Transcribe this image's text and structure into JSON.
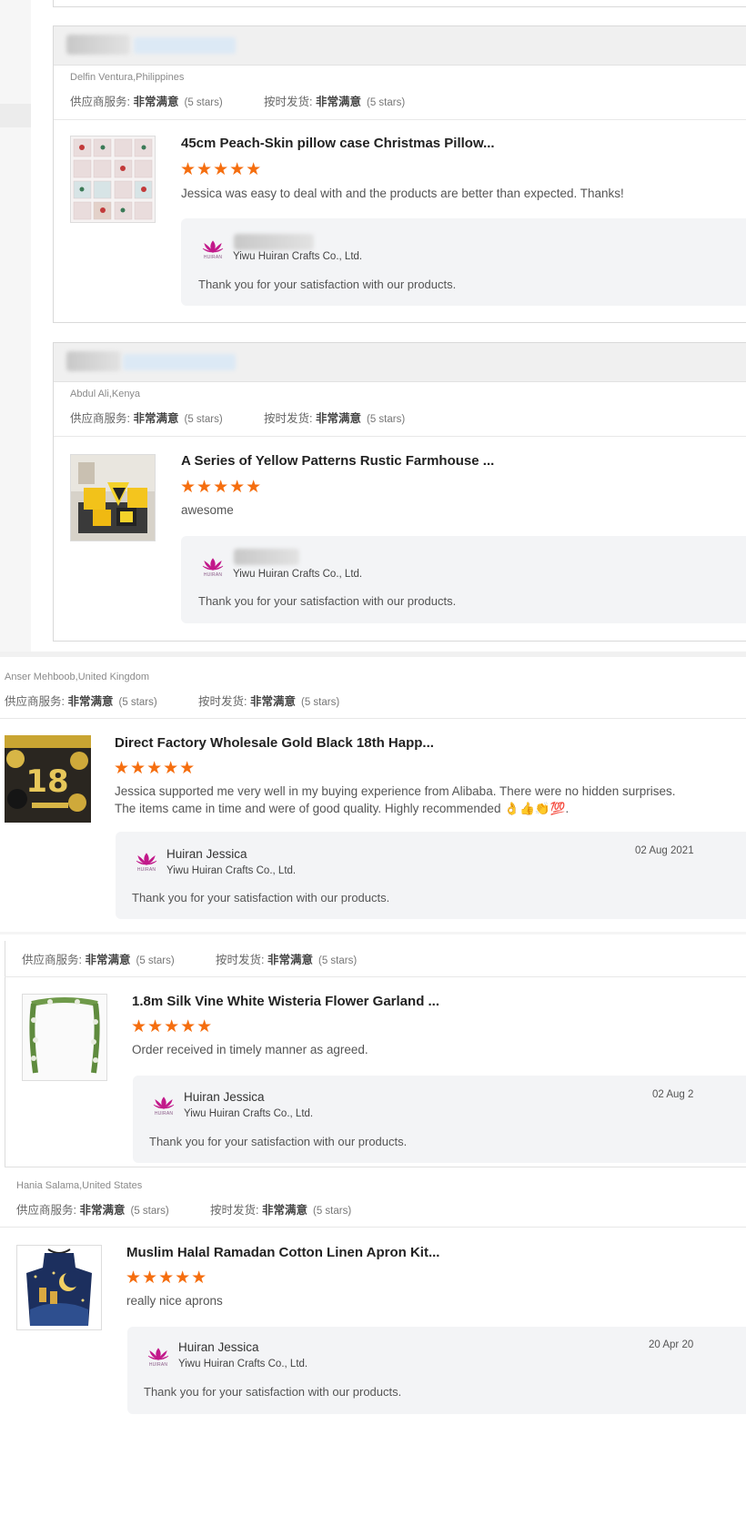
{
  "labels": {
    "supplier_service": "供应商服务:",
    "ontime_delivery": "按时发货:",
    "very_satisfied": "非常满意",
    "five_stars": "(5 stars)",
    "stars_glyphs": "★★★★★"
  },
  "reviews": [
    {
      "buyer": "Delfin Ventura,Philippines",
      "product_title": "45cm Peach-Skin pillow case Christmas Pillow...",
      "review_text": "Jessica was easy to deal with and the products are better than expected. Thanks!",
      "reply": {
        "company": "Yiwu Huiran Crafts Co., Ltd.",
        "message": "Thank you for your satisfaction with our products."
      }
    },
    {
      "buyer": "Abdul Ali,Kenya",
      "product_title": "A Series of Yellow Patterns Rustic Farmhouse ...",
      "review_text": "awesome",
      "reply": {
        "company": "Yiwu Huiran Crafts Co., Ltd.",
        "message": "Thank you for your satisfaction with our products."
      }
    },
    {
      "buyer": "Anser Mehboob,United Kingdom",
      "product_title": "Direct Factory Wholesale Gold Black 18th Happ...",
      "review_text": "Jessica supported me very well in my buying experience from Alibaba. There were no hidden surprises. The items came in time and were of good quality. Highly recommended 👌👍👏💯.",
      "reply": {
        "name": "Huiran Jessica",
        "company": "Yiwu Huiran Crafts Co., Ltd.",
        "message": "Thank you for your satisfaction with our products.",
        "date": "02 Aug 2021"
      }
    },
    {
      "product_title": "1.8m Silk Vine White Wisteria Flower Garland ...",
      "review_text": "Order received in timely manner as agreed.",
      "reply": {
        "name": "Huiran Jessica",
        "company": "Yiwu Huiran Crafts Co., Ltd.",
        "message": "Thank you for your satisfaction with our products.",
        "date": "02 Aug 2"
      }
    },
    {
      "buyer": "Hania Salama,United States",
      "product_title": "Muslim Halal Ramadan Cotton Linen Apron Kit...",
      "review_text": "really nice aprons",
      "reply": {
        "name": "Huiran Jessica",
        "company": "Yiwu Huiran Crafts Co., Ltd.",
        "message": "Thank you for your satisfaction with our products.",
        "date": "20 Apr 20"
      }
    }
  ],
  "logo_text": "HUIRAN",
  "colors": {
    "star": "#f56e0f",
    "reply_bg": "#f3f4f6",
    "logo": "#c2188a"
  }
}
